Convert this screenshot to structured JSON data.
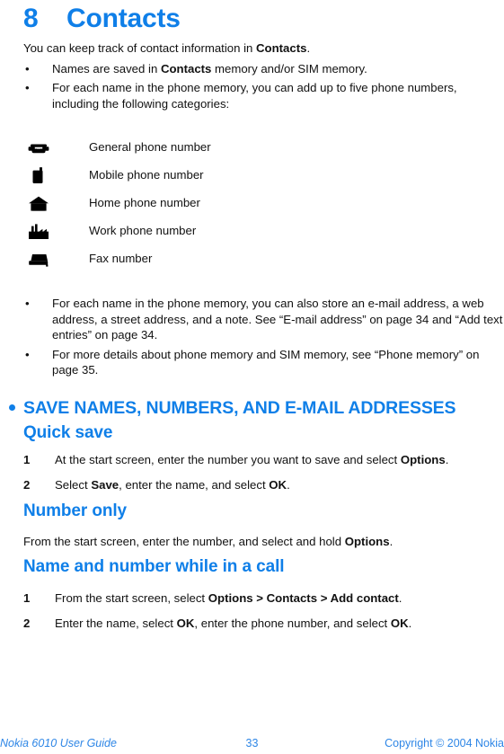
{
  "chapter": {
    "number": "8",
    "title": "Contacts"
  },
  "intro": {
    "lead_a": "You can keep track of contact information in ",
    "lead_b": "Contacts",
    "lead_c": ".",
    "bullets": [
      {
        "marker": "•",
        "parts": [
          {
            "text": "Names are saved in ",
            "bold": false
          },
          {
            "text": "Contacts",
            "bold": true
          },
          {
            "text": " memory and/or SIM memory.",
            "bold": false
          }
        ]
      },
      {
        "marker": "•",
        "parts": [
          {
            "text": "For each name in the phone memory, you can add up to five phone numbers, including the following categories:",
            "bold": false
          }
        ]
      }
    ]
  },
  "number_types": [
    {
      "icon": "telephone-icon",
      "label": "General phone number"
    },
    {
      "icon": "mobile-phone-icon",
      "label": "Mobile phone number"
    },
    {
      "icon": "house-icon",
      "label": "Home phone number"
    },
    {
      "icon": "factory-icon",
      "label": "Work phone number"
    },
    {
      "icon": "fax-machine-icon",
      "label": "Fax number"
    }
  ],
  "post_bullets": [
    {
      "marker": "•",
      "parts": [
        {
          "text": "For each name in the phone memory, you can also store an e-mail address, a web address, a street address, and a note. See “E-mail address” on page 34 and “Add text entries” on page 34.",
          "bold": false
        }
      ]
    },
    {
      "marker": "•",
      "parts": [
        {
          "text": "For more details about phone memory and SIM memory, see “Phone memory” on page 35.",
          "bold": false
        }
      ]
    }
  ],
  "section": {
    "heading": "SAVE NAMES, NUMBERS, AND E-MAIL ADDRESSES",
    "subsections": [
      {
        "heading": "Quick save",
        "steps": [
          {
            "num": "1",
            "parts": [
              {
                "text": "At the start screen, enter the number you want to save and select ",
                "bold": false
              },
              {
                "text": "Options",
                "bold": true
              },
              {
                "text": ".",
                "bold": false
              }
            ]
          },
          {
            "num": "2",
            "parts": [
              {
                "text": "Select ",
                "bold": false
              },
              {
                "text": "Save",
                "bold": true
              },
              {
                "text": ", enter the name, and select ",
                "bold": false
              },
              {
                "text": "OK",
                "bold": true
              },
              {
                "text": ".",
                "bold": false
              }
            ]
          }
        ]
      },
      {
        "heading": "Number only",
        "paragraph": [
          {
            "text": "From the start screen, enter the number, and select and hold ",
            "bold": false
          },
          {
            "text": "Options",
            "bold": true
          },
          {
            "text": ".",
            "bold": false
          }
        ]
      },
      {
        "heading": "Name and number while in a call",
        "steps": [
          {
            "num": "1",
            "parts": [
              {
                "text": "From the start screen, select ",
                "bold": false
              },
              {
                "text": "Options > Contacts > Add contact",
                "bold": true
              },
              {
                "text": ".",
                "bold": false
              }
            ]
          },
          {
            "num": "2",
            "parts": [
              {
                "text": "Enter the name, select ",
                "bold": false
              },
              {
                "text": "OK",
                "bold": true
              },
              {
                "text": ", enter the phone number, and select ",
                "bold": false
              },
              {
                "text": "OK",
                "bold": true
              },
              {
                "text": ".",
                "bold": false
              }
            ]
          }
        ]
      }
    ]
  },
  "footer": {
    "left": "Nokia 6010 User Guide",
    "page": "33",
    "right": "Copyright © 2004 Nokia"
  },
  "colors": {
    "accent_blue": "#0F7FE8",
    "footer_blue": "#2E86E6",
    "body_black": "#111111",
    "page_background": "#FFFFFF"
  }
}
